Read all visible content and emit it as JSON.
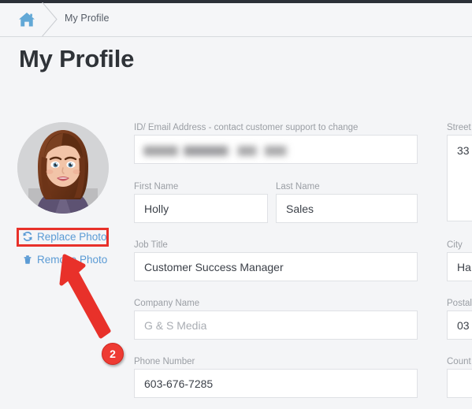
{
  "window": {
    "top_strip_color": "#2b3038",
    "background_color": "#f4f5f7"
  },
  "breadcrumb": {
    "home_icon": "home-icon",
    "items": [
      "My Profile"
    ]
  },
  "page": {
    "title": "My Profile"
  },
  "photo": {
    "avatar_alt": "user-avatar-photo",
    "replace_label": "Replace Photo",
    "replace_icon": "refresh-icon",
    "remove_label": "Remove Photo",
    "remove_icon": "trash-icon"
  },
  "annotation": {
    "badge_number": "2",
    "highlight_color": "#e8312a",
    "badge_color": "#ee3b33",
    "target": "Replace Photo"
  },
  "form": {
    "email": {
      "label": "ID/ Email Address - contact customer support to change",
      "value": "",
      "redacted": true
    },
    "first_name": {
      "label": "First Name",
      "value": "Holly"
    },
    "last_name": {
      "label": "Last Name",
      "value": "Sales"
    },
    "job_title": {
      "label": "Job Title",
      "value": "Customer Success Manager"
    },
    "company_name": {
      "label": "Company Name",
      "value": "",
      "placeholder": "G & S Media"
    },
    "phone_number": {
      "label": "Phone Number",
      "value": "603-676-7285"
    },
    "street": {
      "label": "Street",
      "value": "33"
    },
    "city": {
      "label": "City",
      "value": "Ha"
    },
    "postal": {
      "label": "Postal",
      "value": "03"
    },
    "country": {
      "label": "Count",
      "value": ""
    }
  }
}
